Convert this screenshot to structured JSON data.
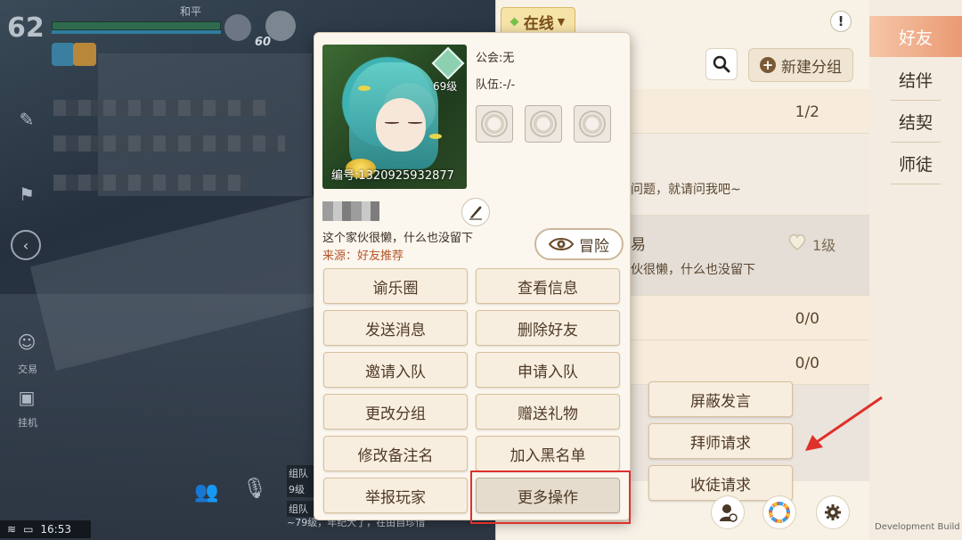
{
  "game": {
    "level": "62",
    "peace_label": "和平",
    "hud_number": "60",
    "time": "16:53",
    "chat_stubs": [
      "组队",
      "9级",
      "组队"
    ],
    "chat_line": "~79级，年纪大了，在由自珍惜",
    "side_labels": [
      "交易",
      "挂机"
    ]
  },
  "friend_panel": {
    "status_label": "在线",
    "new_group_label": "新建分组",
    "rows": [
      {
        "count": "1/2"
      },
      {
        "text": "问题，就请问我吧~"
      },
      {
        "name_tail": "易",
        "text": "伙很懒，什么也没留下",
        "intimacy": "1级"
      },
      {
        "count": "0/0"
      },
      {
        "count": "0/0"
      }
    ],
    "context_menu": [
      "屏蔽发言",
      "拜师请求",
      "收徒请求"
    ],
    "dev_build": "Development Build"
  },
  "tabs": [
    "好友",
    "结伴",
    "结契",
    "师徒"
  ],
  "card": {
    "level": "69级",
    "player_id": "编号:1320925932877",
    "guild": "公会:无",
    "team": "队伍:-/-",
    "bio": "这个家伙很懒，什么也没留下",
    "source": "来源：好友推荐",
    "adventure_label": "冒险",
    "actions": [
      [
        "谕乐圈",
        "查看信息"
      ],
      [
        "发送消息",
        "删除好友"
      ],
      [
        "邀请入队",
        "申请入队"
      ],
      [
        "更改分组",
        "赠送礼物"
      ],
      [
        "修改备注名",
        "加入黑名单"
      ],
      [
        "举报玩家",
        "更多操作"
      ]
    ]
  },
  "colors": {
    "accent_tab": "#ea9a72",
    "annotation_red": "#e0302a",
    "online_green": "#78c24a"
  }
}
